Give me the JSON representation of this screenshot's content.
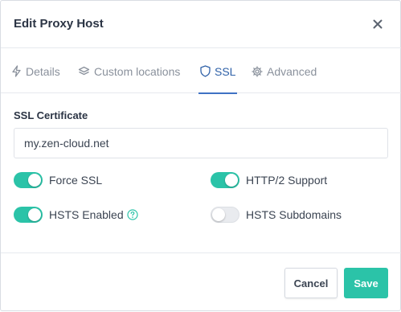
{
  "modal": {
    "title": "Edit Proxy Host"
  },
  "tabs": [
    {
      "label": "Details",
      "icon": "bolt-icon",
      "active": false
    },
    {
      "label": "Custom locations",
      "icon": "layers-icon",
      "active": false
    },
    {
      "label": "SSL",
      "icon": "shield-icon",
      "active": true
    },
    {
      "label": "Advanced",
      "icon": "gear-icon",
      "active": false
    }
  ],
  "ssl": {
    "certificate_label": "SSL Certificate",
    "certificate_value": "my.zen-cloud.net"
  },
  "toggles": {
    "force_ssl": {
      "label": "Force SSL",
      "checked": true
    },
    "http2": {
      "label": "HTTP/2 Support",
      "checked": true
    },
    "hsts_enabled": {
      "label": "HSTS Enabled",
      "checked": true
    },
    "hsts_subdomains": {
      "label": "HSTS Subdomains",
      "checked": false
    }
  },
  "footer": {
    "cancel_label": "Cancel",
    "save_label": "Save"
  },
  "colors": {
    "accent": "#2bc3a8",
    "active_tab": "#2f61a8"
  }
}
